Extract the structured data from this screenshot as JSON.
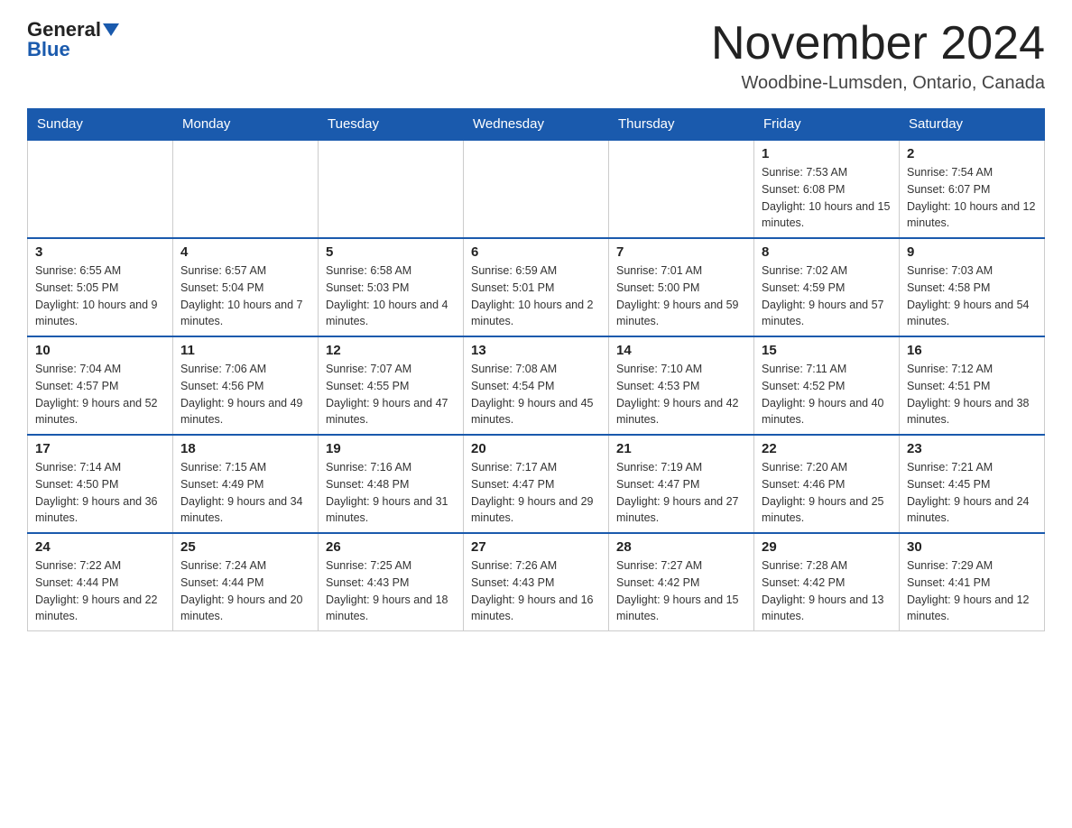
{
  "header": {
    "logo_general": "General",
    "logo_blue": "Blue",
    "month_title": "November 2024",
    "location": "Woodbine-Lumsden, Ontario, Canada"
  },
  "weekdays": [
    "Sunday",
    "Monday",
    "Tuesday",
    "Wednesday",
    "Thursday",
    "Friday",
    "Saturday"
  ],
  "weeks": [
    [
      {
        "day": "",
        "sunrise": "",
        "sunset": "",
        "daylight": ""
      },
      {
        "day": "",
        "sunrise": "",
        "sunset": "",
        "daylight": ""
      },
      {
        "day": "",
        "sunrise": "",
        "sunset": "",
        "daylight": ""
      },
      {
        "day": "",
        "sunrise": "",
        "sunset": "",
        "daylight": ""
      },
      {
        "day": "",
        "sunrise": "",
        "sunset": "",
        "daylight": ""
      },
      {
        "day": "1",
        "sunrise": "7:53 AM",
        "sunset": "6:08 PM",
        "daylight": "10 hours and 15 minutes."
      },
      {
        "day": "2",
        "sunrise": "7:54 AM",
        "sunset": "6:07 PM",
        "daylight": "10 hours and 12 minutes."
      }
    ],
    [
      {
        "day": "3",
        "sunrise": "6:55 AM",
        "sunset": "5:05 PM",
        "daylight": "10 hours and 9 minutes."
      },
      {
        "day": "4",
        "sunrise": "6:57 AM",
        "sunset": "5:04 PM",
        "daylight": "10 hours and 7 minutes."
      },
      {
        "day": "5",
        "sunrise": "6:58 AM",
        "sunset": "5:03 PM",
        "daylight": "10 hours and 4 minutes."
      },
      {
        "day": "6",
        "sunrise": "6:59 AM",
        "sunset": "5:01 PM",
        "daylight": "10 hours and 2 minutes."
      },
      {
        "day": "7",
        "sunrise": "7:01 AM",
        "sunset": "5:00 PM",
        "daylight": "9 hours and 59 minutes."
      },
      {
        "day": "8",
        "sunrise": "7:02 AM",
        "sunset": "4:59 PM",
        "daylight": "9 hours and 57 minutes."
      },
      {
        "day": "9",
        "sunrise": "7:03 AM",
        "sunset": "4:58 PM",
        "daylight": "9 hours and 54 minutes."
      }
    ],
    [
      {
        "day": "10",
        "sunrise": "7:04 AM",
        "sunset": "4:57 PM",
        "daylight": "9 hours and 52 minutes."
      },
      {
        "day": "11",
        "sunrise": "7:06 AM",
        "sunset": "4:56 PM",
        "daylight": "9 hours and 49 minutes."
      },
      {
        "day": "12",
        "sunrise": "7:07 AM",
        "sunset": "4:55 PM",
        "daylight": "9 hours and 47 minutes."
      },
      {
        "day": "13",
        "sunrise": "7:08 AM",
        "sunset": "4:54 PM",
        "daylight": "9 hours and 45 minutes."
      },
      {
        "day": "14",
        "sunrise": "7:10 AM",
        "sunset": "4:53 PM",
        "daylight": "9 hours and 42 minutes."
      },
      {
        "day": "15",
        "sunrise": "7:11 AM",
        "sunset": "4:52 PM",
        "daylight": "9 hours and 40 minutes."
      },
      {
        "day": "16",
        "sunrise": "7:12 AM",
        "sunset": "4:51 PM",
        "daylight": "9 hours and 38 minutes."
      }
    ],
    [
      {
        "day": "17",
        "sunrise": "7:14 AM",
        "sunset": "4:50 PM",
        "daylight": "9 hours and 36 minutes."
      },
      {
        "day": "18",
        "sunrise": "7:15 AM",
        "sunset": "4:49 PM",
        "daylight": "9 hours and 34 minutes."
      },
      {
        "day": "19",
        "sunrise": "7:16 AM",
        "sunset": "4:48 PM",
        "daylight": "9 hours and 31 minutes."
      },
      {
        "day": "20",
        "sunrise": "7:17 AM",
        "sunset": "4:47 PM",
        "daylight": "9 hours and 29 minutes."
      },
      {
        "day": "21",
        "sunrise": "7:19 AM",
        "sunset": "4:47 PM",
        "daylight": "9 hours and 27 minutes."
      },
      {
        "day": "22",
        "sunrise": "7:20 AM",
        "sunset": "4:46 PM",
        "daylight": "9 hours and 25 minutes."
      },
      {
        "day": "23",
        "sunrise": "7:21 AM",
        "sunset": "4:45 PM",
        "daylight": "9 hours and 24 minutes."
      }
    ],
    [
      {
        "day": "24",
        "sunrise": "7:22 AM",
        "sunset": "4:44 PM",
        "daylight": "9 hours and 22 minutes."
      },
      {
        "day": "25",
        "sunrise": "7:24 AM",
        "sunset": "4:44 PM",
        "daylight": "9 hours and 20 minutes."
      },
      {
        "day": "26",
        "sunrise": "7:25 AM",
        "sunset": "4:43 PM",
        "daylight": "9 hours and 18 minutes."
      },
      {
        "day": "27",
        "sunrise": "7:26 AM",
        "sunset": "4:43 PM",
        "daylight": "9 hours and 16 minutes."
      },
      {
        "day": "28",
        "sunrise": "7:27 AM",
        "sunset": "4:42 PM",
        "daylight": "9 hours and 15 minutes."
      },
      {
        "day": "29",
        "sunrise": "7:28 AM",
        "sunset": "4:42 PM",
        "daylight": "9 hours and 13 minutes."
      },
      {
        "day": "30",
        "sunrise": "7:29 AM",
        "sunset": "4:41 PM",
        "daylight": "9 hours and 12 minutes."
      }
    ]
  ]
}
